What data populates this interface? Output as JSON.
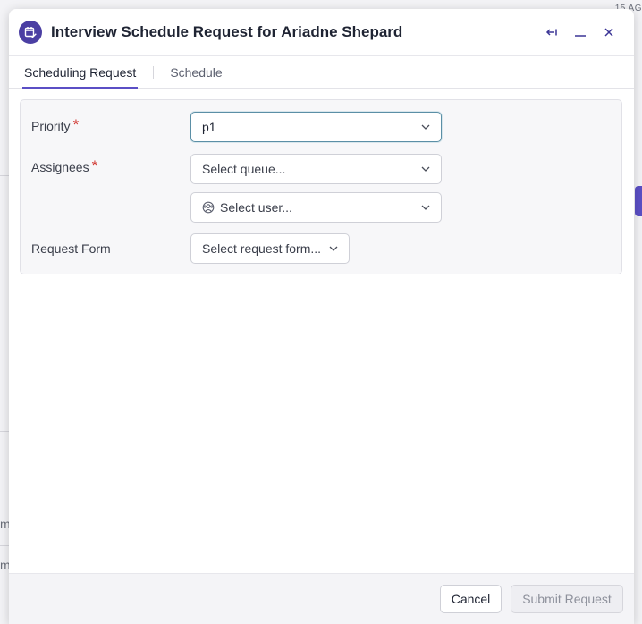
{
  "background": {
    "date_fragment": "15 AG",
    "row_fragment_1": "m",
    "row_fragment_2": "m",
    "plus_glyph": "+"
  },
  "modal": {
    "title": "Interview Schedule Request for Ariadne Shepard",
    "header_icon": "calendar-edit-icon",
    "controls": {
      "back_icon": "arrow-left-bar-icon",
      "minimize_icon": "minimize-icon",
      "close_icon": "close-icon"
    }
  },
  "tabs": [
    {
      "label": "Scheduling Request",
      "active": true
    },
    {
      "label": "Schedule",
      "active": false
    }
  ],
  "form": {
    "priority": {
      "label": "Priority",
      "required_mark": "*",
      "value": "p1"
    },
    "assignees": {
      "label": "Assignees",
      "required_mark": "*",
      "queue_placeholder": "Select queue...",
      "user_placeholder": "Select user..."
    },
    "request_form": {
      "label": "Request Form",
      "placeholder": "Select request form..."
    }
  },
  "footer": {
    "cancel_label": "Cancel",
    "submit_label": "Submit Request"
  },
  "colors": {
    "accent": "#5b4fc5",
    "header_icon_bg": "#4b3fa3",
    "required": "#d0352f",
    "focus_border": "#5b8fa6"
  }
}
